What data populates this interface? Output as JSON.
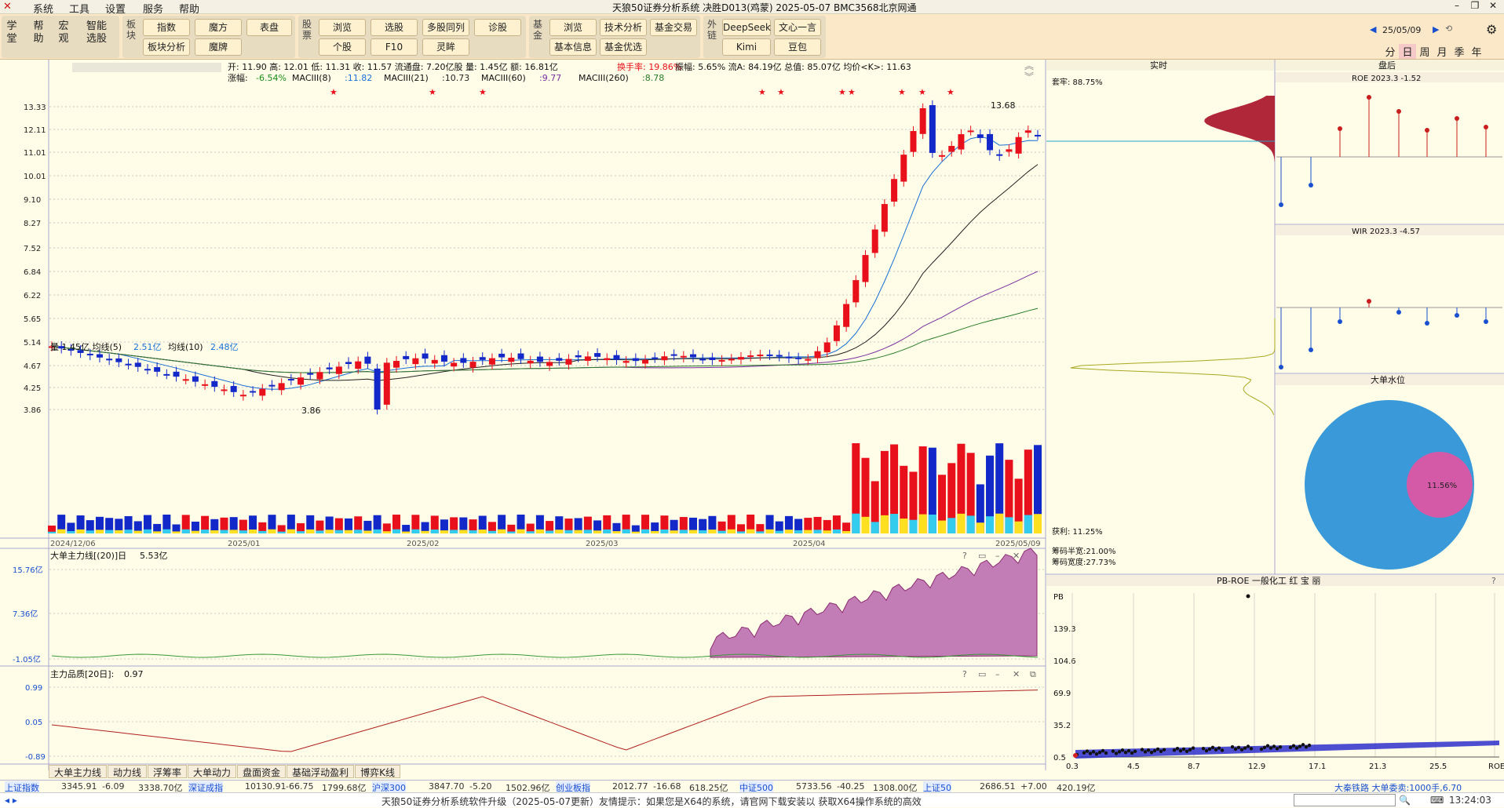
{
  "app": {
    "title": "天狼50证券分析系统  决胜D013(鸡蒙)  2025-05-07 BMC3568北京网通",
    "menus": [
      "系统",
      "工具",
      "设置",
      "服务",
      "帮助"
    ]
  },
  "toolbar": {
    "left_groups": [
      {
        "label": "学堂"
      },
      {
        "label": "帮助"
      },
      {
        "label": "宏观"
      },
      {
        "label": "智能选股"
      }
    ],
    "block_label": "板块",
    "block_buttons": [
      "指数",
      "魔方",
      "表盘",
      "板块分析",
      "魔牌"
    ],
    "stock_label": "股票",
    "stock_buttons": [
      "浏览",
      "选股",
      "多股同列",
      "诊股",
      "个股",
      "F10",
      "灵眸"
    ],
    "fund_label": "基金",
    "fund_buttons": [
      "浏览",
      "技术分析",
      "基金交易",
      "基本信息",
      "基金优选"
    ],
    "ext_label": "外链",
    "ext_buttons": [
      "DeepSeek",
      "文心一言",
      "Kimi",
      "豆包"
    ],
    "date": "25/05/09",
    "periods": [
      "分",
      "日",
      "周",
      "月",
      "季",
      "年"
    ],
    "active_period": "日"
  },
  "quote": {
    "line1": "开: 11.90 高: 12.01 低: 11.31 收: 11.57 流通盘: 7.20亿股 量: 1.45亿 额: 16.81亿",
    "turnover": "换手率: 19.86%",
    "line1b": "振幅: 5.65% 流A: 84.19亿 总值: 85.07亿 均价<K>: 11.63",
    "line2_label": "涨幅:",
    "line2_change": "-6.54%",
    "ma_labels": [
      "MACIII(8)",
      "MACIII(21)",
      "MACIII(60)",
      "MACIII(260)"
    ],
    "ma_values": [
      ":11.82",
      ":10.73",
      ":9.77",
      ":8.78"
    ],
    "ma_colors": [
      "#1a6fd6",
      "#222",
      "#7a2fa0",
      "#2a7a2a"
    ]
  },
  "price_axis": [
    "13.33",
    "12.11",
    "11.01",
    "10.01",
    "9.10",
    "8.27",
    "7.52",
    "6.84",
    "6.22",
    "5.65",
    "5.14",
    "4.67",
    "4.25",
    "3.86"
  ],
  "price_labels": {
    "high": "13.68",
    "low": "3.86"
  },
  "volume": {
    "label": "量 1.45亿 均线(5)",
    "ma5": "2.51亿",
    "ma10_label": "均线(10)",
    "ma10": "2.48亿"
  },
  "date_axis": [
    "2024/12/06",
    "2025/01",
    "2025/02",
    "2025/03",
    "2025/04",
    "2025/05/09"
  ],
  "ind1": {
    "title": "大单主力线[(20)]日",
    "value": "5.53亿",
    "axis": [
      "15.76亿",
      "7.36亿",
      "-1.05亿"
    ]
  },
  "ind2": {
    "title": "主力品质[20日]:",
    "value": "0.97",
    "axis": [
      "0.99",
      "0.05",
      "-0.89"
    ]
  },
  "indicator_tabs": [
    "大单主力线",
    "动力线",
    "浮筹率",
    "大单动力",
    "盘面资金",
    "基础浮动盈利",
    "博弈K线"
  ],
  "chips": {
    "header": "实时",
    "taolao": "套牢: 88.75%",
    "profit": "获利: 11.25%",
    "half": "筹码半宽:21.00%",
    "width": "筹码宽度:27.73%"
  },
  "right": {
    "header": "盘后",
    "roe_title": "ROE 2023.3 -1.52",
    "wir_title": "WIR 2023.3 -4.57",
    "bigorder_title": "大单水位",
    "pie_label": "11.56%",
    "pb_title": "PB-ROE 一般化工 红 宝 丽",
    "pb_y": [
      "PB",
      "139.3",
      "104.6",
      "69.9",
      "35.2",
      "0.5"
    ],
    "pb_x": [
      "0.3",
      "4.5",
      "8.7",
      "12.9",
      "17.1",
      "21.3",
      "25.5",
      "ROE"
    ]
  },
  "colors": {
    "up": "#e8101a",
    "down": "#1228c8",
    "ma8": "#1a6fd6",
    "ma21": "#222222",
    "ma60": "#7a2fa0",
    "ma260": "#2a7a2a",
    "bg": "#fffde7"
  },
  "status": {
    "indices": [
      {
        "name": "上证指数",
        "v1": "3345.91",
        "v2": "-6.09",
        "v3": "3338.70亿"
      },
      {
        "name": "深证成指",
        "v1": "10130.91",
        "v2": "-66.75",
        "v3": "1799.68亿"
      },
      {
        "name": "沪深300",
        "v1": "3847.70",
        "v2": "-5.20",
        "v3": "1502.96亿"
      },
      {
        "name": "创业板指",
        "v1": "2012.77",
        "v2": "-16.68",
        "v3": "618.25亿"
      },
      {
        "name": "中证500",
        "v1": "5733.56",
        "v2": "-40.25",
        "v3": "1308.00亿"
      },
      {
        "name": "上证50",
        "v1": "2686.51",
        "v2": "+7.00",
        "v3": "420.19亿"
      }
    ],
    "right_text": "大秦铁路  大单委卖:1000手,6.70"
  },
  "message": "天狼50证券分析系统软件升级（2025-05-07更新）友情提示：如果您是X64的系统，请官网下载安装以  获取X64操作系统的高效",
  "clock": "13:24:03"
}
